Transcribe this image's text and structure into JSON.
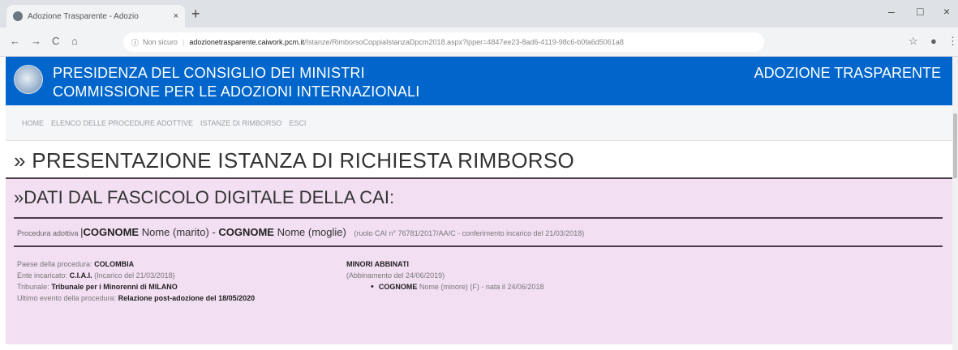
{
  "browser": {
    "tab_title": "Adozione Trasparente - Adozio",
    "tab_close": "×",
    "new_tab": "+",
    "win_minimize": "–",
    "win_maximize": "□",
    "win_close": "×",
    "back": "←",
    "forward": "→",
    "reload": "C",
    "home": "⌂",
    "security_icon": "ⓘ",
    "security_label": "Non sicuro",
    "url_host": "adozionetrasparente.caiwork.pcm.it",
    "url_path": "/Istanze/RimborsoCoppiaIstanzaDpcm2018.aspx?ipper=4847ee23-8ad6-4119-98c6-b0fa6d5061a8",
    "star_icon": "☆",
    "profile_icon": "●",
    "menu_icon": "⋮"
  },
  "header": {
    "line1": "PRESIDENZA DEL CONSIGLIO DEI MINISTRI",
    "line2": "COMMISSIONE PER LE ADOZIONI INTERNAZIONALI",
    "right": "ADOZIONE TRASPARENTE",
    "brand_color": "#0066cc"
  },
  "menu": {
    "items": [
      "HOME",
      "ELENCO DELLE PROCEDURE ADOTTIVE",
      "ISTANZE DI RIMBORSO",
      "ESCI"
    ]
  },
  "page": {
    "title": "» PRESENTAZIONE ISTANZA DI RICHIESTA RIMBORSO"
  },
  "panel": {
    "title": "»DATI DAL FASCICOLO DIGITALE DELLA CAI:",
    "background": "#f2dff2",
    "procedure_label": "Procedura adottiva",
    "husband_surname": "COGNOME",
    "husband_rest": "Nome (marito) -",
    "wife_surname": "COGNOME",
    "wife_rest": "Nome (moglie)",
    "procedure_meta": "(ruolo CAI n° 76781/2017/AA/C - conferimento incarico del 21/03/2018)",
    "paese_label": "Paese della procedura:",
    "paese_value": "COLOMBIA",
    "ente_label": "Ente incaricato:",
    "ente_value": "C.I.A.I.",
    "ente_note": "(Incarico del 21/03/2018)",
    "tribunale_label": "Tribunale:",
    "tribunale_value": "Tribunale per i Minorenni di MILANO",
    "evento_label": "Ultimo evento della procedura:",
    "evento_value": "Relazione post-adozione del 18/05/2020",
    "minori_head": "MINORI ABBINATI",
    "abbinamento": "(Abbinamento del 24/06/2019)",
    "minore_surname": "COGNOME",
    "minore_rest": "Nome (minore) (F) - nata il 24/06/2018"
  }
}
